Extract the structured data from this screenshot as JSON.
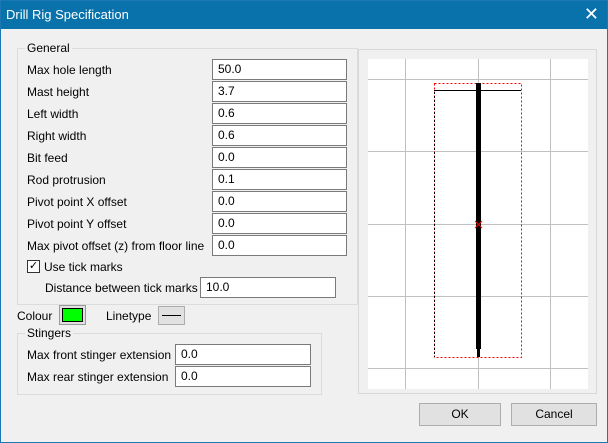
{
  "title": "Drill Rig Specification",
  "general": {
    "label": "General",
    "fields": [
      {
        "label": "Max hole length",
        "value": "50.0"
      },
      {
        "label": "Mast height",
        "value": "3.7"
      },
      {
        "label": "Left width",
        "value": "0.6"
      },
      {
        "label": "Right width",
        "value": "0.6"
      },
      {
        "label": "Bit feed",
        "value": "0.0"
      },
      {
        "label": "Rod protrusion",
        "value": "0.1"
      },
      {
        "label": "Pivot point X offset",
        "value": "0.0"
      },
      {
        "label": "Pivot point Y offset",
        "value": "0.0"
      },
      {
        "label": "Max pivot offset (z) from floor line",
        "value": "0.0"
      }
    ],
    "use_tick_marks": {
      "label": "Use tick marks",
      "checked": true
    },
    "tick_distance": {
      "label": "Distance between tick marks",
      "value": "10.0"
    }
  },
  "colour": {
    "label": "Colour",
    "value": "#00ff00"
  },
  "linetype": {
    "label": "Linetype"
  },
  "stingers": {
    "label": "Stingers",
    "fields": [
      {
        "label": "Max front stinger extension",
        "value": "0.0"
      },
      {
        "label": "Max rear stinger extension",
        "value": "0.0"
      }
    ]
  },
  "buttons": {
    "ok": "OK",
    "cancel": "Cancel"
  }
}
